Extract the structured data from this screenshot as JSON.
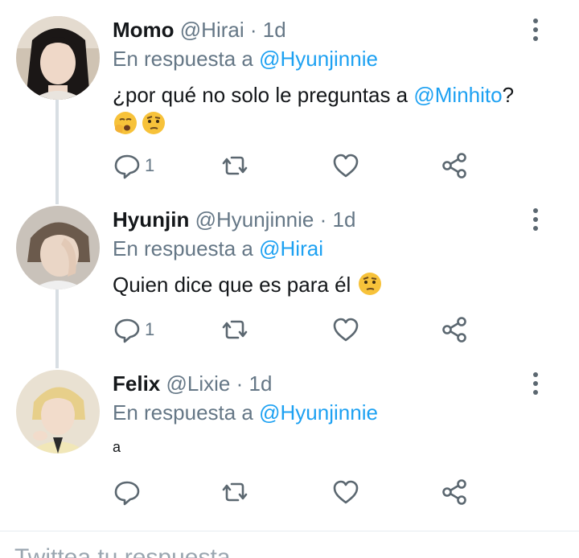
{
  "tweets": [
    {
      "name": "Momo",
      "handle": "@Hirai",
      "dot": "·",
      "time": "1d",
      "reply_prefix": "En respuesta a",
      "reply_to": "@Hyunjinnie",
      "text_before": "¿por qué no solo le preguntas a ",
      "text_mention": "@Minhito",
      "text_after": "?",
      "emojis": [
        "yawning-face",
        "face-with-raised-eyebrow"
      ],
      "reply_count": "1"
    },
    {
      "name": "Hyunjin",
      "handle": "@Hyunjinnie",
      "dot": "·",
      "time": "1d",
      "reply_prefix": "En respuesta a",
      "reply_to": "@Hirai",
      "text": "Quien dice que es para él",
      "emojis": [
        "face-with-raised-eyebrow"
      ],
      "reply_count": "1"
    },
    {
      "name": "Felix",
      "handle": "@Lixie",
      "dot": "·",
      "time": "1d",
      "reply_prefix": "En respuesta a",
      "reply_to": "@Hyunjinnie",
      "text": "a",
      "reply_count": ""
    }
  ],
  "reply_bar": {
    "placeholder": "Twittea tu respuesta"
  },
  "colors": {
    "mention": "#1da1f2",
    "muted": "#657786",
    "icon": "#5b6770",
    "thread_line": "#d8dee3"
  }
}
